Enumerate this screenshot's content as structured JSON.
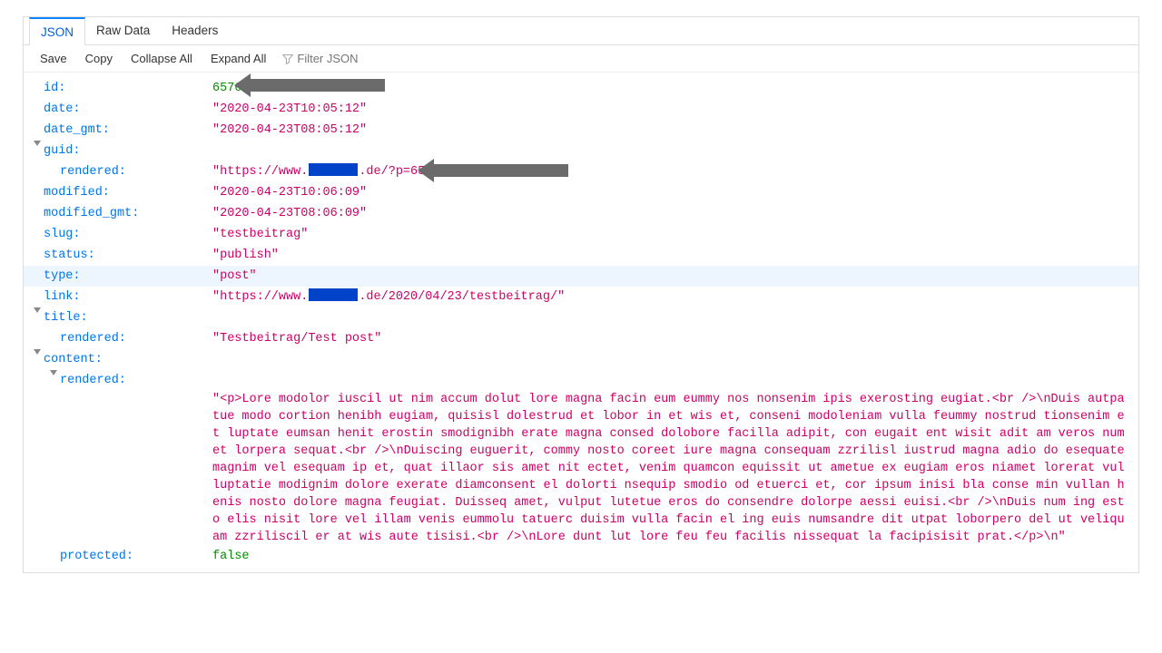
{
  "tabs": {
    "json": "JSON",
    "raw": "Raw Data",
    "headers": "Headers"
  },
  "toolbar": {
    "save": "Save",
    "copy": "Copy",
    "collapse": "Collapse All",
    "expand": "Expand All",
    "filter_placeholder": "Filter JSON"
  },
  "rows": {
    "id_key": "id:",
    "id_val": "6576",
    "date_key": "date:",
    "date_val": "\"2020-04-23T10:05:12\"",
    "date_gmt_key": "date_gmt:",
    "date_gmt_val": "\"2020-04-23T08:05:12\"",
    "guid_key": "guid:",
    "guid_rendered_key": "rendered:",
    "guid_rendered_pre": "\"https://www.",
    "guid_rendered_post": ".de/?p=6576\"",
    "modified_key": "modified:",
    "modified_val": "\"2020-04-23T10:06:09\"",
    "modified_gmt_key": "modified_gmt:",
    "modified_gmt_val": "\"2020-04-23T08:06:09\"",
    "slug_key": "slug:",
    "slug_val": "\"testbeitrag\"",
    "status_key": "status:",
    "status_val": "\"publish\"",
    "type_key": "type:",
    "type_val": "\"post\"",
    "link_key": "link:",
    "link_pre": "\"https://www.",
    "link_post": ".de/2020/04/23/testbeitrag/\"",
    "title_key": "title:",
    "title_rendered_key": "rendered:",
    "title_rendered_val": "\"Testbeitrag/Test post\"",
    "content_key": "content:",
    "content_rendered_key": "rendered:",
    "content_rendered_val": "\"<p>Lore modolor iuscil ut nim accum dolut lore magna facin eum eummy nos nonsenim ipis exerosting eugiat.<br />\\nDuis autpatue modo cortion henibh eugiam, quisisl dolestrud et lobor in et wis et, conseni modoleniam vulla feummy nostrud tionsenim et luptate eumsan henit erostin smodignibh erate magna consed dolobore facilla adipit, con eugait ent wisit adit am veros num et lorpera sequat.<br />\\nDuiscing euguerit, commy nosto coreet iure magna consequam zzrilisl iustrud magna adio do esequate magnim vel esequam ip et, quat illaor sis amet nit ectet, venim quamcon equissit ut ametue ex eugiam eros niamet lorerat vulluptatie modignim dolore exerate diamconsent el dolorti nsequip smodio od etuerci et, cor ipsum inisi bla conse min vullan henis nosto dolore magna feugiat. Duisseq amet, vulput lutetue eros do consendre dolorpe aessi euisi.<br />\\nDuis num ing esto elis nisit lore vel illam venis eummolu tatuerc duisim vulla facin el ing euis numsandre dit utpat loborpero del ut veliquam zzriliscil er at wis aute tisisi.<br />\\nLore dunt lut lore feu feu facilis nissequat la facipisisit prat.</p>\\n\"",
    "protected_key": "protected:",
    "protected_val": "false"
  }
}
